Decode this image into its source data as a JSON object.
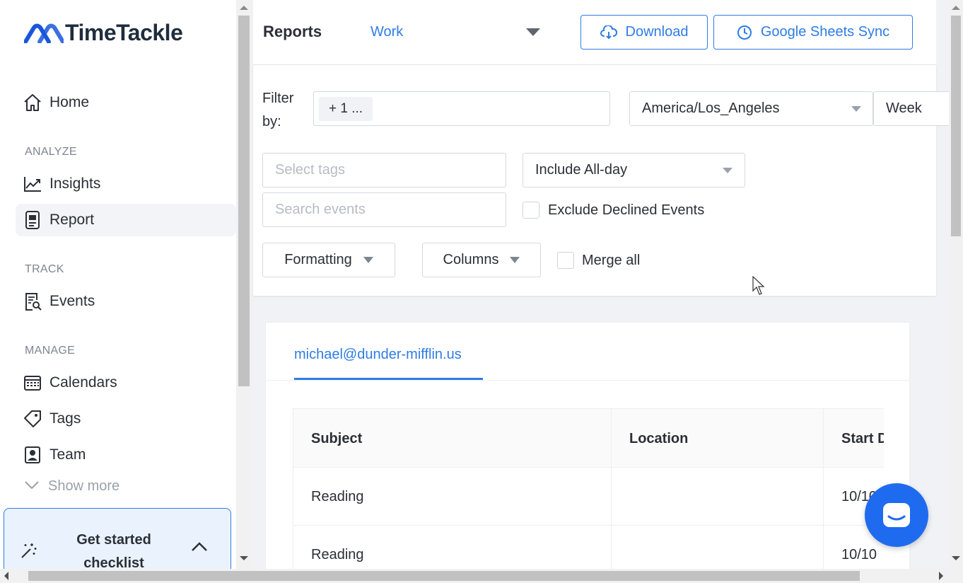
{
  "app": {
    "name": "TimeTackle",
    "brand_color": "#2e7ce6"
  },
  "sidebar": {
    "home": "Home",
    "sections": {
      "analyze": "ANALYZE",
      "track": "TRACK",
      "manage": "MANAGE"
    },
    "items": {
      "insights": "Insights",
      "report": "Report",
      "events": "Events",
      "calendars": "Calendars",
      "tags": "Tags",
      "team": "Team"
    },
    "show_more": "Show more",
    "checklist": "Get started checklist"
  },
  "header": {
    "title": "Reports",
    "workspace": "Work",
    "download": "Download",
    "sheets_sync": "Google Sheets Sync"
  },
  "filters": {
    "filter_by_label": "Filter by:",
    "filter_chip": "+ 1 ...",
    "timezone": "America/Los_Angeles",
    "period": "Week",
    "tags_placeholder": "Select tags",
    "search_placeholder": "Search events",
    "allday": "Include All-day",
    "exclude_declined": "Exclude Declined Events",
    "formatting": "Formatting",
    "columns": "Columns",
    "merge_all": "Merge all"
  },
  "report": {
    "tab": "michael@dunder-mifflin.us",
    "headers": {
      "subject": "Subject",
      "location": "Location",
      "start": "Start D"
    },
    "rows": [
      {
        "subject": "Reading",
        "location": "",
        "start": "10/10"
      },
      {
        "subject": "Reading",
        "location": "",
        "start": "10/10"
      }
    ]
  }
}
